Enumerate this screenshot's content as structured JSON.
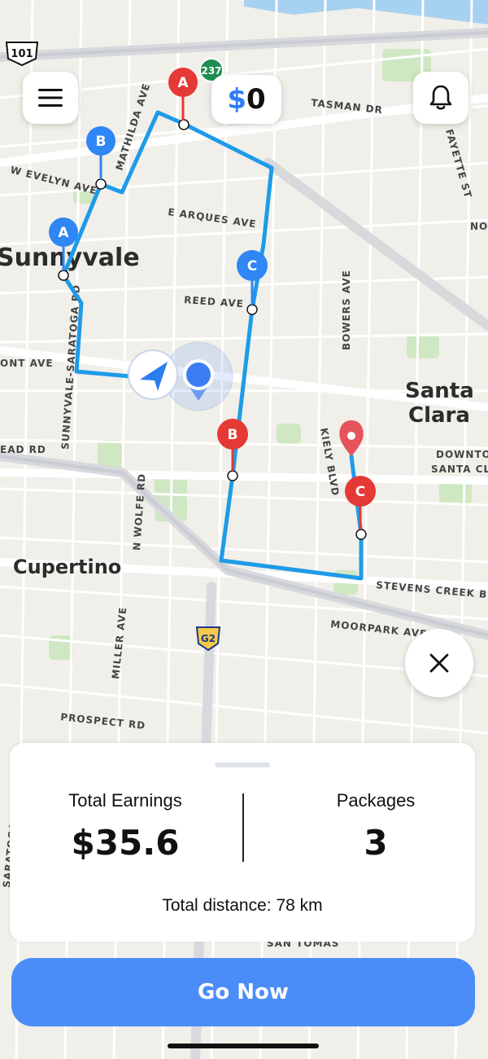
{
  "header": {
    "balance_currency": "$",
    "balance_amount": "0"
  },
  "map": {
    "cities": [
      "Sunnyvale",
      "Santa",
      "Clara",
      "Cupertino",
      "DOWNTO",
      "SANTA CL"
    ],
    "streets": [
      "TASMAN DR",
      "W EVELYN AVE",
      "E ARQUES AVE",
      "REED AVE",
      "MATHILDA AVE",
      "SUNNYVALE-SARATOGA RD",
      "BOWERS AVE",
      "KIELY BLVD",
      "N WOLFE RD",
      "STEVENS CREEK B",
      "MOORPARK AVE",
      "MILLER AVE",
      "PROSPECT RD",
      "SAN TOMAS",
      "FAYETTE ST",
      "ONT AVE",
      "EAD RD",
      "SARATOGA-SUNNY",
      "NO"
    ],
    "highway_shields": [
      "101",
      "237",
      "G2"
    ],
    "route_markers": [
      {
        "label": "A",
        "color": "#e53935"
      },
      {
        "label": "B",
        "color": "#2f86f5"
      },
      {
        "label": "A",
        "color": "#2f86f5"
      },
      {
        "label": "C",
        "color": "#2f86f5"
      },
      {
        "label": "B",
        "color": "#e53935"
      },
      {
        "label": "C",
        "color": "#e53935"
      }
    ],
    "route_color": "#1e9be9",
    "location_color": "#3d7df3"
  },
  "summary": {
    "earnings_label": "Total Earnings",
    "earnings_value": "$35.6",
    "packages_label": "Packages",
    "packages_value": "3",
    "distance_text": "Total distance: 78 km"
  },
  "action": {
    "go_label": "Go Now"
  },
  "icons": {
    "menu": "hamburger-menu-icon",
    "bell": "bell-icon",
    "close": "close-icon",
    "navigate": "navigation-arrow-icon",
    "destination": "map-pin-icon"
  }
}
